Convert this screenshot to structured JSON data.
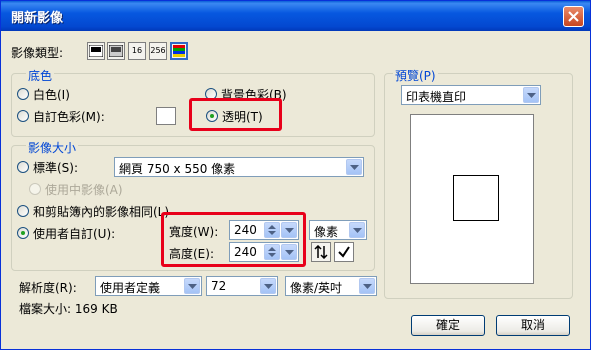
{
  "window": {
    "title": "開新影像"
  },
  "image_type": {
    "label": "影像類型:",
    "buttons": [
      {
        "name": "black-white",
        "text": ""
      },
      {
        "name": "grayscale",
        "text": ""
      },
      {
        "name": "16-color",
        "text": "16"
      },
      {
        "name": "256-color",
        "text": "256"
      },
      {
        "name": "true-color",
        "text": ""
      }
    ]
  },
  "background": {
    "title": "底色",
    "white": "白色(I)",
    "bg_color": "背景色彩(B)",
    "custom": "自訂色彩(M):",
    "transparent": "透明(T)",
    "selected": "transparent"
  },
  "image_size": {
    "title": "影像大小",
    "standard": "標準(S):",
    "standard_value": "網頁 750 x 550 像素",
    "active_image": "使用中影像(A)",
    "clipboard": "和剪貼簿內的影像相同(L)",
    "user_defined": "使用者自訂(U):",
    "width_label": "寬度(W):",
    "width_value": "240",
    "height_label": "高度(E):",
    "height_value": "240",
    "unit": "像素",
    "selected": "user_defined"
  },
  "resolution": {
    "label": "解析度(R):",
    "mode": "使用者定義",
    "value": "72",
    "unit": "像素/英吋"
  },
  "file_size": "檔案大小: 169 KB",
  "preview": {
    "title": "預覽(P)",
    "mode": "印表機直印"
  },
  "buttons": {
    "ok": "確定",
    "cancel": "取消"
  },
  "colors": {
    "title_bar": "#0348d0",
    "group_title": "#0046d5",
    "highlight": "#e8001a"
  }
}
